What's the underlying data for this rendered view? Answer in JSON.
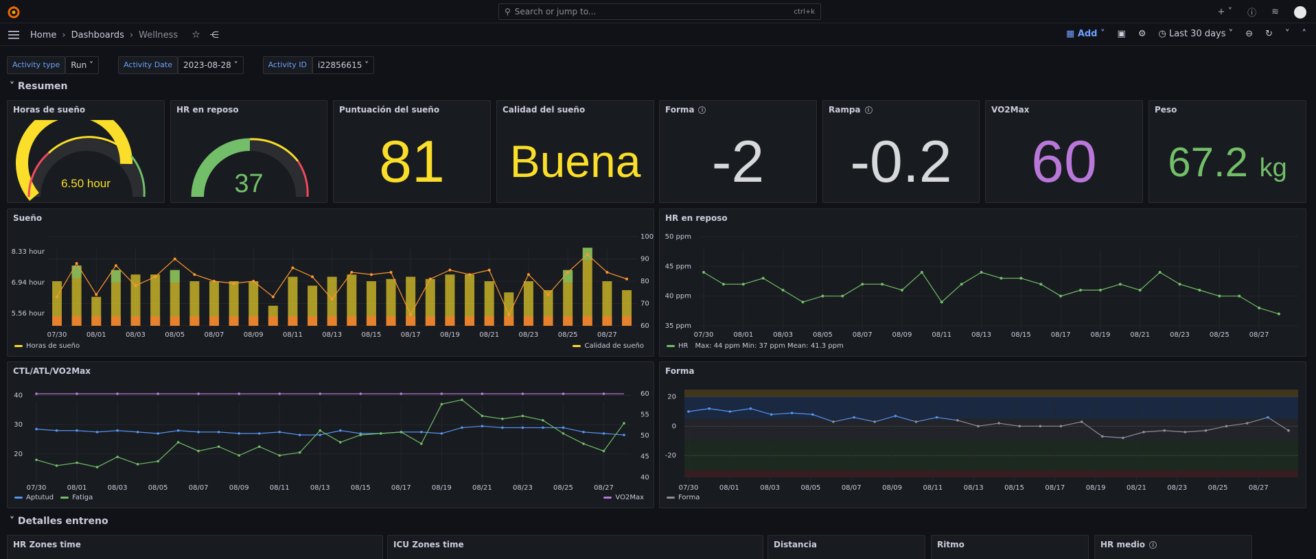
{
  "topbar": {
    "search_placeholder": "Search or jump to...",
    "shortcut": "ctrl+k"
  },
  "breadcrumb": {
    "home": "Home",
    "dashboards": "Dashboards",
    "current": "Wellness"
  },
  "toolbar": {
    "add_label": "Add",
    "time_range": "Last 30 days"
  },
  "variables": [
    {
      "label": "Activity type",
      "value": "Run"
    },
    {
      "label": "Activity Date",
      "value": "2023-08-28"
    },
    {
      "label": "Activity ID",
      "value": "i22856615"
    }
  ],
  "rows": {
    "resumen": "Resumen",
    "detalles": "Detalles entreno"
  },
  "colors": {
    "yellow": "#fade2a",
    "green": "#73bf69",
    "purple": "#b877d9",
    "blue": "#5794f2",
    "orange": "#ff9830",
    "white": "#d8d9da"
  },
  "stats": {
    "horas_sueno": {
      "title": "Horas de sueño",
      "value": "6.50 hour"
    },
    "hr_reposo": {
      "title": "HR en reposo",
      "value": "37"
    },
    "puntuacion": {
      "title": "Puntuación del sueño",
      "value": "81"
    },
    "calidad": {
      "title": "Calidad del sueño",
      "value": "Buena"
    },
    "forma": {
      "title": "Forma",
      "value": "-2"
    },
    "rampa": {
      "title": "Rampa",
      "value": "-0.2"
    },
    "vo2max": {
      "title": "VO2Max",
      "value": "60"
    },
    "peso": {
      "title": "Peso",
      "value": "67.2",
      "unit": "kg"
    }
  },
  "x_dates": [
    "07/30",
    "08/01",
    "08/03",
    "08/05",
    "08/07",
    "08/09",
    "08/11",
    "08/13",
    "08/15",
    "08/17",
    "08/19",
    "08/21",
    "08/23",
    "08/25",
    "08/27"
  ],
  "sueno_chart": {
    "title": "Sueño",
    "y_left_ticks": [
      "8.33 hour",
      "6.94 hour",
      "5.56 hour"
    ],
    "y_right_ticks": [
      "100",
      "90",
      "80",
      "70",
      "60"
    ],
    "legend_left": "Horas de sueño",
    "legend_right": "Calidad de sueño",
    "chart_data": {
      "type": "bar",
      "categories": [
        "07/30",
        "07/31",
        "08/01",
        "08/02",
        "08/03",
        "08/04",
        "08/05",
        "08/06",
        "08/07",
        "08/08",
        "08/09",
        "08/10",
        "08/11",
        "08/12",
        "08/13",
        "08/14",
        "08/15",
        "08/16",
        "08/17",
        "08/18",
        "08/19",
        "08/20",
        "08/21",
        "08/22",
        "08/23",
        "08/24",
        "08/25",
        "08/26",
        "08/27",
        "08/28"
      ],
      "series": [
        {
          "name": "Horas de sueño",
          "values": [
            7.0,
            7.7,
            6.3,
            7.5,
            7.3,
            7.3,
            7.5,
            7.0,
            7.0,
            7.0,
            7.0,
            5.9,
            7.2,
            6.8,
            7.2,
            7.3,
            7.0,
            7.1,
            7.2,
            7.1,
            7.3,
            7.3,
            7.0,
            6.5,
            7.0,
            6.6,
            7.5,
            8.5,
            7.0,
            6.6
          ]
        },
        {
          "name": "Calidad de sueño",
          "values": [
            73,
            88,
            74,
            87,
            78,
            82,
            90,
            83,
            80,
            79,
            80,
            73,
            86,
            82,
            72,
            84,
            83,
            84,
            65,
            81,
            85,
            83,
            85,
            65,
            83,
            74,
            84,
            92,
            84,
            81
          ]
        }
      ]
    }
  },
  "hr_chart": {
    "title": "HR en reposo",
    "y_ticks": [
      "50 ppm",
      "45 ppm",
      "40 ppm",
      "35 ppm"
    ],
    "legend_name": "HR",
    "legend_stats": "Max: 44 ppm   Min: 37 ppm   Mean: 41.3 ppm",
    "chart_data": {
      "type": "line",
      "x": [
        "07/30",
        "07/31",
        "08/01",
        "08/02",
        "08/03",
        "08/04",
        "08/05",
        "08/06",
        "08/07",
        "08/08",
        "08/09",
        "08/10",
        "08/11",
        "08/12",
        "08/13",
        "08/14",
        "08/15",
        "08/16",
        "08/17",
        "08/18",
        "08/19",
        "08/20",
        "08/21",
        "08/22",
        "08/23",
        "08/24",
        "08/25",
        "08/26",
        "08/27",
        "08/28"
      ],
      "series": [
        {
          "name": "HR",
          "values": [
            44,
            42,
            42,
            43,
            41,
            39,
            40,
            40,
            42,
            42,
            41,
            44,
            39,
            42,
            44,
            43,
            43,
            42,
            40,
            41,
            41,
            42,
            41,
            44,
            42,
            41,
            40,
            40,
            38,
            37
          ]
        }
      ]
    }
  },
  "ctl_chart": {
    "title": "CTL/ATL/VO2Max",
    "y_left_ticks": [
      "40",
      "30",
      "20"
    ],
    "y_right_ticks": [
      "60",
      "55",
      "50",
      "45",
      "40"
    ],
    "legend": [
      "Aptutud",
      "Fatiga"
    ],
    "legend_right": "VO2Max",
    "chart_data": {
      "type": "line",
      "x": [
        "07/30",
        "07/31",
        "08/01",
        "08/02",
        "08/03",
        "08/04",
        "08/05",
        "08/06",
        "08/07",
        "08/08",
        "08/09",
        "08/10",
        "08/11",
        "08/12",
        "08/13",
        "08/14",
        "08/15",
        "08/16",
        "08/17",
        "08/18",
        "08/19",
        "08/20",
        "08/21",
        "08/22",
        "08/23",
        "08/24",
        "08/25",
        "08/26",
        "08/27",
        "08/28"
      ],
      "series": [
        {
          "name": "Aptutud",
          "values": [
            28.5,
            28,
            28,
            27.5,
            28,
            27.5,
            27,
            28,
            27.5,
            27.5,
            27,
            27,
            27.5,
            26.5,
            26.5,
            28,
            27,
            27,
            27.5,
            27.5,
            27,
            29,
            29.5,
            29,
            29,
            29,
            29,
            27.5,
            27,
            26.5
          ]
        },
        {
          "name": "Fatiga",
          "values": [
            18,
            16,
            17,
            15.5,
            19,
            16.5,
            17.5,
            24,
            21,
            22.5,
            19.5,
            22.5,
            19.5,
            20.5,
            28,
            24,
            26.5,
            27,
            27.5,
            23.5,
            37,
            38.5,
            33,
            32,
            33,
            31.5,
            27,
            23.5,
            21,
            30.5
          ]
        },
        {
          "name": "VO2Max",
          "values": [
            60,
            60,
            60,
            60,
            60,
            60,
            60,
            60,
            60,
            60,
            60,
            60,
            60,
            60,
            60,
            60,
            60,
            60,
            60,
            60,
            60,
            60,
            60,
            60,
            60,
            60,
            60,
            60,
            60,
            60
          ]
        }
      ]
    }
  },
  "forma_chart": {
    "title": "Forma",
    "y_ticks": [
      "20",
      "0",
      "-20"
    ],
    "legend_name": "Forma",
    "chart_data": {
      "type": "line",
      "x": [
        "07/30",
        "07/31",
        "08/01",
        "08/02",
        "08/03",
        "08/04",
        "08/05",
        "08/06",
        "08/07",
        "08/08",
        "08/09",
        "08/10",
        "08/11",
        "08/12",
        "08/13",
        "08/14",
        "08/15",
        "08/16",
        "08/17",
        "08/18",
        "08/19",
        "08/20",
        "08/21",
        "08/22",
        "08/23",
        "08/24",
        "08/25",
        "08/26",
        "08/27",
        "08/28"
      ],
      "series": [
        {
          "name": "Forma",
          "values": [
            10,
            12,
            10,
            12,
            8,
            9,
            8,
            3,
            6,
            3,
            7,
            3,
            6,
            4,
            0,
            2,
            0,
            0,
            0,
            3,
            -7,
            -8,
            -4,
            -3,
            -4,
            -3,
            0,
            2,
            6,
            -3
          ]
        }
      ]
    }
  },
  "bottom_panels": [
    "HR Zones time",
    "ICU Zones time",
    "Distancia",
    "Ritmo",
    "HR medio"
  ]
}
